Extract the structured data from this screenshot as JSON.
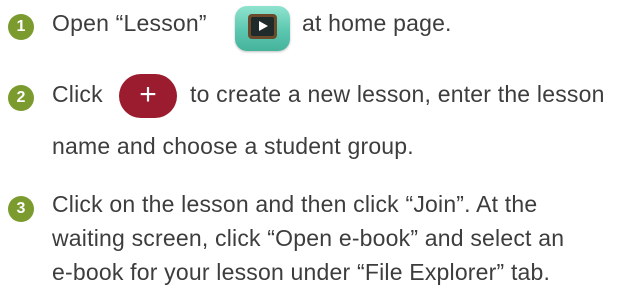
{
  "colors": {
    "step_badge": "#7b9b2f",
    "plus_button": "#9b1b2f",
    "text": "#3d3d3d",
    "lesson_icon": "#5cc7b0"
  },
  "steps": [
    {
      "number": "1",
      "lines": [
        "Open “Lesson”",
        "at home page."
      ],
      "icon": "lesson-app-icon"
    },
    {
      "number": "2",
      "lines": [
        "Click",
        "to create a new lesson, enter the lesson",
        "name and choose a student group."
      ],
      "icon": "plus-button-icon",
      "button_label": "+"
    },
    {
      "number": "3",
      "lines": [
        "Click on the lesson and then click “Join”. At the",
        "waiting screen, click “Open e-book” and select an",
        "e-book for your lesson under “File Explorer” tab."
      ]
    }
  ]
}
